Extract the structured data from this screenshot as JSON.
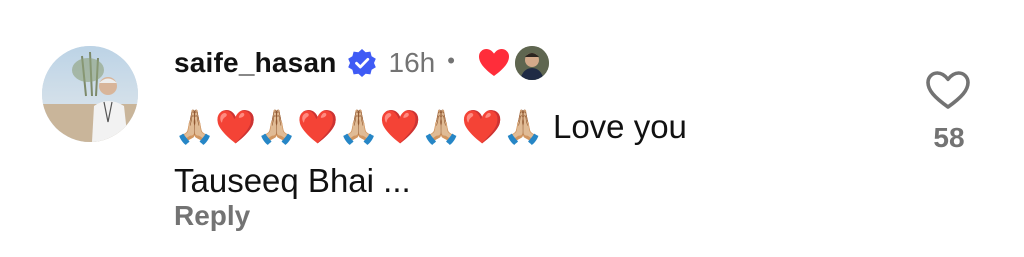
{
  "comment": {
    "username": "saife_hasan",
    "time": "16h",
    "separator": "•",
    "text": "🙏🏼❤️🙏🏼❤️🙏🏼❤️🙏🏼❤️🙏🏼 Love you Tauseeq Bhai ...",
    "reply_label": "Reply",
    "like_count": "58",
    "verified": true,
    "liked_by_author": true
  },
  "icons": {
    "verified": "verified-badge-icon",
    "author_like": "heart-icon",
    "like": "heart-outline-icon"
  },
  "colors": {
    "verified_blue": "#3f5bf5",
    "heart_red": "#ff2d3a",
    "muted_text": "#737373",
    "primary_text": "#111111"
  }
}
